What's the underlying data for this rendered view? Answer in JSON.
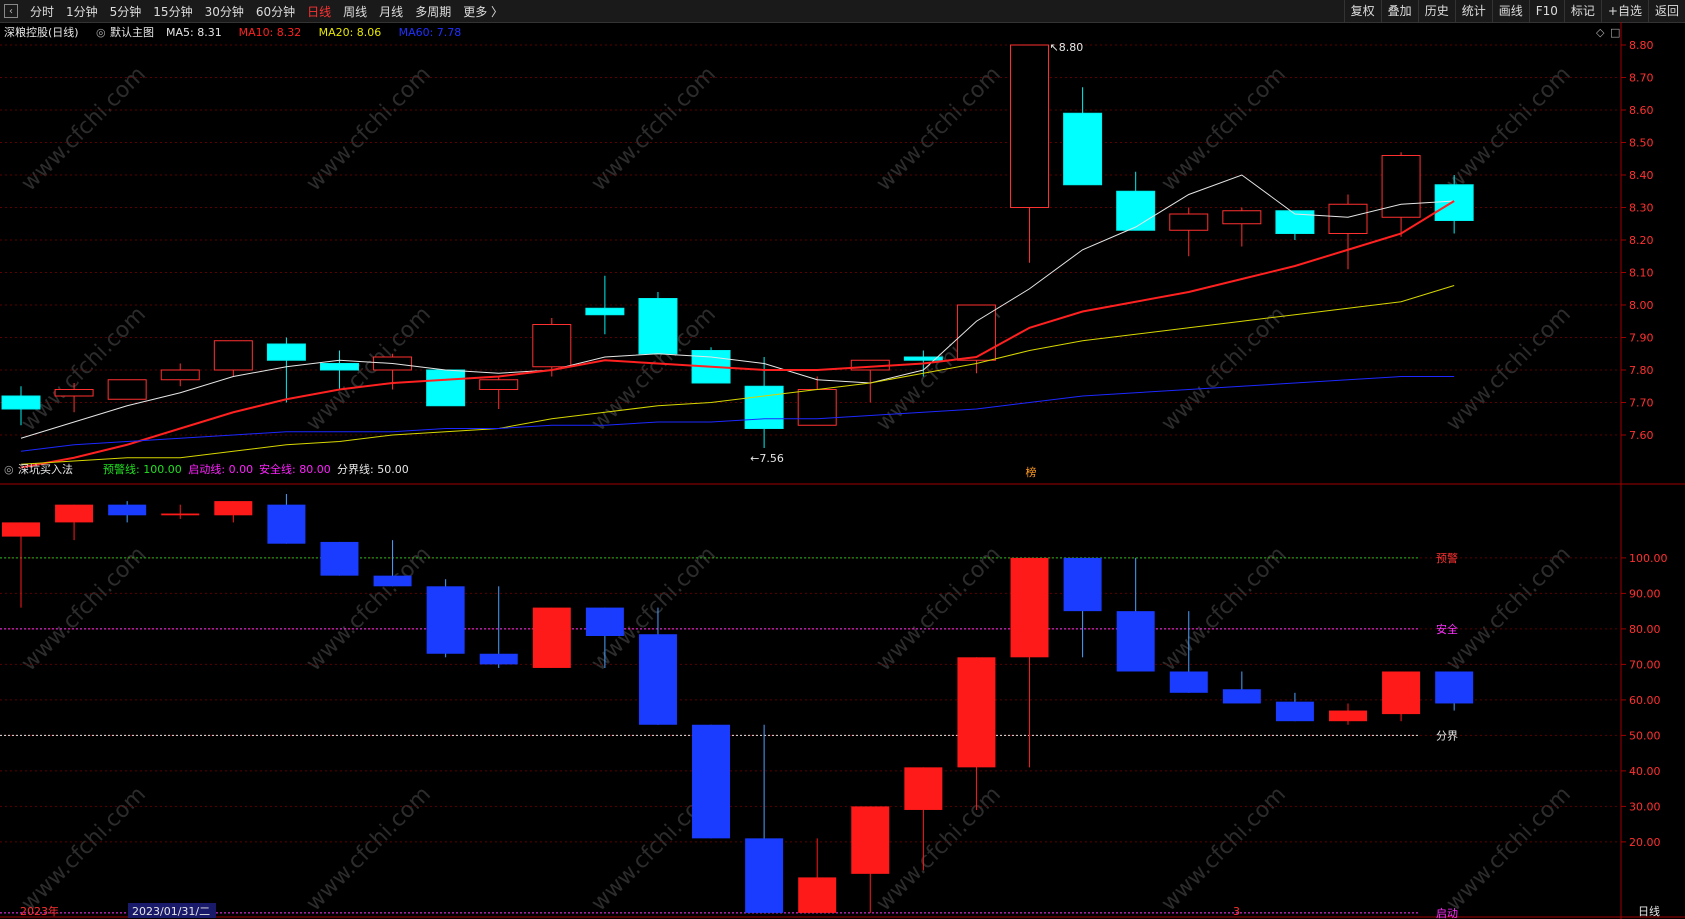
{
  "toolbar": {
    "nav_icon": "left-arrow-icon",
    "timeframes": [
      "分时",
      "1分钟",
      "5分钟",
      "15分钟",
      "30分钟",
      "60分钟",
      "日线",
      "周线",
      "月线",
      "多周期",
      "更多 〉"
    ],
    "active": "日线",
    "right_buttons": [
      "复权",
      "叠加",
      "历史",
      "统计",
      "画线",
      "F10",
      "标记",
      "+自选",
      "返回"
    ]
  },
  "main_panel": {
    "stock_title": "深粮控股(日线)",
    "template_label": "默认主图",
    "ma": [
      {
        "label": "MA5: 8.31",
        "color": "#e6e6e6"
      },
      {
        "label": "MA10: 8.32",
        "color": "#ff2020"
      },
      {
        "label": "MA20: 8.06",
        "color": "#e6e600"
      },
      {
        "label": "MA60: 7.78",
        "color": "#2030ff"
      }
    ],
    "high_marker": "8.80",
    "low_marker": "7.56",
    "event_tag": "榜"
  },
  "indicator_panel": {
    "name": "深坑买入法",
    "params": [
      {
        "label": "预警线: 100.00",
        "color": "#20e020"
      },
      {
        "label": "启动线: 0.00",
        "color": "#ff20ff"
      },
      {
        "label": "安全线: 80.00",
        "color": "#ff20ff"
      },
      {
        "label": "分界线: 50.00",
        "color": "#e6e6e6"
      }
    ],
    "line_labels": [
      {
        "text": "预警",
        "value": 100,
        "color": "#ff3232",
        "line": "#20c020"
      },
      {
        "text": "安全",
        "value": 80,
        "color": "#ff30ff",
        "line": "#ff30ff"
      },
      {
        "text": "分界",
        "value": 50,
        "color": "#e6e6e6",
        "line": "#e6e6e6"
      },
      {
        "text": "启动",
        "value": 0,
        "color": "#ff30ff",
        "line": "#ff30ff"
      }
    ]
  },
  "bottom": {
    "year_label": "2023年",
    "date_label": "2023/01/31/二",
    "month_label": "3",
    "period_label": "日线"
  },
  "watermark": "www.cfchi.com",
  "chart_data": [
    {
      "type": "candlestick",
      "title": "深粮控股(日线)",
      "ylim": [
        7.48,
        8.84
      ],
      "y_ticks": [
        7.6,
        7.7,
        7.8,
        7.9,
        8.0,
        8.1,
        8.2,
        8.3,
        8.4,
        8.5,
        8.6,
        8.7,
        8.8
      ],
      "candles": [
        {
          "o": 7.68,
          "c": 7.72,
          "h": 7.75,
          "l": 7.63,
          "up": false
        },
        {
          "o": 7.72,
          "c": 7.74,
          "h": 7.76,
          "l": 7.67,
          "up": true
        },
        {
          "o": 7.71,
          "c": 7.77,
          "h": 7.77,
          "l": 7.71,
          "up": true
        },
        {
          "o": 7.77,
          "c": 7.8,
          "h": 7.82,
          "l": 7.75,
          "up": true
        },
        {
          "o": 7.8,
          "c": 7.89,
          "h": 7.89,
          "l": 7.78,
          "up": true
        },
        {
          "o": 7.88,
          "c": 7.83,
          "h": 7.9,
          "l": 7.7,
          "up": false
        },
        {
          "o": 7.82,
          "c": 7.8,
          "h": 7.86,
          "l": 7.74,
          "up": false
        },
        {
          "o": 7.8,
          "c": 7.84,
          "h": 7.85,
          "l": 7.74,
          "up": true
        },
        {
          "o": 7.8,
          "c": 7.69,
          "h": 7.8,
          "l": 7.69,
          "up": false
        },
        {
          "o": 7.74,
          "c": 7.77,
          "h": 7.78,
          "l": 7.68,
          "up": true
        },
        {
          "o": 7.81,
          "c": 7.94,
          "h": 7.96,
          "l": 7.78,
          "up": true
        },
        {
          "o": 7.99,
          "c": 7.97,
          "h": 8.09,
          "l": 7.91,
          "up": false
        },
        {
          "o": 8.02,
          "c": 7.85,
          "h": 8.04,
          "l": 7.85,
          "up": false
        },
        {
          "o": 7.86,
          "c": 7.76,
          "h": 7.87,
          "l": 7.76,
          "up": false
        },
        {
          "o": 7.75,
          "c": 7.62,
          "h": 7.84,
          "l": 7.56,
          "up": false
        },
        {
          "o": 7.63,
          "c": 7.74,
          "h": 7.78,
          "l": 7.63,
          "up": true
        },
        {
          "o": 7.8,
          "c": 7.83,
          "h": 7.83,
          "l": 7.7,
          "up": true
        },
        {
          "o": 7.84,
          "c": 7.83,
          "h": 7.86,
          "l": 7.78,
          "up": false
        },
        {
          "o": 7.83,
          "c": 8.0,
          "h": 8.0,
          "l": 7.79,
          "up": true
        },
        {
          "o": 8.3,
          "c": 8.8,
          "h": 8.8,
          "l": 8.13,
          "up": true
        },
        {
          "o": 8.59,
          "c": 8.37,
          "h": 8.67,
          "l": 8.37,
          "up": false
        },
        {
          "o": 8.35,
          "c": 8.23,
          "h": 8.41,
          "l": 8.23,
          "up": false
        },
        {
          "o": 8.23,
          "c": 8.28,
          "h": 8.3,
          "l": 8.15,
          "up": true
        },
        {
          "o": 8.25,
          "c": 8.29,
          "h": 8.3,
          "l": 8.18,
          "up": true
        },
        {
          "o": 8.29,
          "c": 8.22,
          "h": 8.29,
          "l": 8.2,
          "up": false
        },
        {
          "o": 8.22,
          "c": 8.31,
          "h": 8.34,
          "l": 8.11,
          "up": true
        },
        {
          "o": 8.27,
          "c": 8.46,
          "h": 8.47,
          "l": 8.21,
          "up": true
        },
        {
          "o": 8.37,
          "c": 8.26,
          "h": 8.4,
          "l": 8.22,
          "up": false
        }
      ],
      "ma": {
        "MA5": [
          7.59,
          7.64,
          7.69,
          7.73,
          7.78,
          7.81,
          7.83,
          7.82,
          7.8,
          7.79,
          7.8,
          7.84,
          7.85,
          7.84,
          7.82,
          7.77,
          7.76,
          7.8,
          7.95,
          8.05,
          8.17,
          8.24,
          8.34,
          8.4,
          8.28,
          8.27,
          8.31,
          8.32
        ],
        "MA10": [
          7.5,
          7.53,
          7.57,
          7.62,
          7.67,
          7.71,
          7.74,
          7.76,
          7.77,
          7.78,
          7.8,
          7.83,
          7.82,
          7.81,
          7.8,
          7.8,
          7.81,
          7.82,
          7.84,
          7.93,
          7.98,
          8.01,
          8.04,
          8.08,
          8.12,
          8.17,
          8.22,
          8.32
        ],
        "MA20": [
          7.51,
          7.52,
          7.53,
          7.53,
          7.55,
          7.57,
          7.58,
          7.6,
          7.61,
          7.62,
          7.65,
          7.67,
          7.69,
          7.7,
          7.72,
          7.74,
          7.76,
          7.79,
          7.82,
          7.86,
          7.89,
          7.91,
          7.93,
          7.95,
          7.97,
          7.99,
          8.01,
          8.06
        ],
        "MA60": [
          7.55,
          7.57,
          7.58,
          7.59,
          7.6,
          7.61,
          7.61,
          7.61,
          7.62,
          7.62,
          7.63,
          7.63,
          7.64,
          7.64,
          7.65,
          7.65,
          7.66,
          7.67,
          7.68,
          7.7,
          7.72,
          7.73,
          7.74,
          7.75,
          7.76,
          7.77,
          7.78,
          7.78
        ]
      }
    },
    {
      "type": "candlestick-indicator",
      "title": "深坑买入法",
      "ylim": [
        -2,
        118
      ],
      "y_ticks": [
        20,
        30,
        40,
        50,
        60,
        70,
        80,
        90,
        100
      ],
      "bars": [
        {
          "o": 106,
          "c": 110,
          "h": 110,
          "l": 86,
          "color": "red"
        },
        {
          "o": 110,
          "c": 115,
          "h": 115,
          "l": 105,
          "color": "red"
        },
        {
          "o": 115,
          "c": 112,
          "h": 116,
          "l": 110,
          "color": "blue"
        },
        {
          "o": 112,
          "c": 112.5,
          "h": 115,
          "l": 111,
          "color": "red"
        },
        {
          "o": 112,
          "c": 116,
          "h": 116,
          "l": 110,
          "color": "red"
        },
        {
          "o": 115,
          "c": 104,
          "h": 118,
          "l": 104,
          "color": "blue"
        },
        {
          "o": 104.5,
          "c": 95,
          "h": 104.5,
          "l": 95,
          "color": "blue"
        },
        {
          "o": 95,
          "c": 92,
          "h": 105,
          "l": 92,
          "color": "blue"
        },
        {
          "o": 92,
          "c": 73,
          "h": 94,
          "l": 72,
          "color": "blue"
        },
        {
          "o": 73,
          "c": 70,
          "h": 92,
          "l": 69,
          "color": "blue"
        },
        {
          "o": 69,
          "c": 86,
          "h": 86,
          "l": 69,
          "color": "red"
        },
        {
          "o": 86,
          "c": 78,
          "h": 86,
          "l": 69,
          "color": "blue"
        },
        {
          "o": 78.5,
          "c": 53,
          "h": 86,
          "l": 53,
          "color": "blue"
        },
        {
          "o": 53,
          "c": 21,
          "h": 53,
          "l": 21,
          "color": "blue"
        },
        {
          "o": 21,
          "c": 0,
          "h": 53,
          "l": 0,
          "color": "blue"
        },
        {
          "o": 0,
          "c": 10,
          "h": 21,
          "l": 0,
          "color": "red"
        },
        {
          "o": 11,
          "c": 30,
          "h": 30,
          "l": 0,
          "color": "red"
        },
        {
          "o": 29,
          "c": 41,
          "h": 41,
          "l": 12,
          "color": "red"
        },
        {
          "o": 41,
          "c": 72,
          "h": 72,
          "l": 29,
          "color": "red"
        },
        {
          "o": 72,
          "c": 100,
          "h": 100,
          "l": 41,
          "color": "red"
        },
        {
          "o": 100,
          "c": 85,
          "h": 100,
          "l": 72,
          "color": "blue"
        },
        {
          "o": 85,
          "c": 68,
          "h": 100,
          "l": 68,
          "color": "blue"
        },
        {
          "o": 68,
          "c": 62,
          "h": 85,
          "l": 62,
          "color": "blue"
        },
        {
          "o": 63,
          "c": 59,
          "h": 68,
          "l": 59,
          "color": "blue"
        },
        {
          "o": 59.5,
          "c": 54,
          "h": 62,
          "l": 54,
          "color": "blue"
        },
        {
          "o": 54,
          "c": 57,
          "h": 59,
          "l": 53,
          "color": "red"
        },
        {
          "o": 56,
          "c": 68,
          "h": 68,
          "l": 54,
          "color": "red"
        },
        {
          "o": 68,
          "c": 59,
          "h": 68,
          "l": 57,
          "color": "blue"
        }
      ]
    }
  ]
}
